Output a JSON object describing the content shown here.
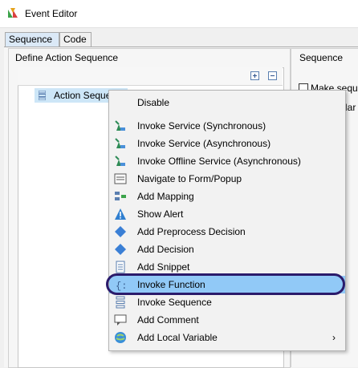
{
  "window": {
    "title": "Event Editor"
  },
  "tabs": [
    {
      "label": "Sequence"
    },
    {
      "label": "Code"
    }
  ],
  "left_group": {
    "title": "Define Action Sequence",
    "tree_item": "Action Sequence"
  },
  "right_group": {
    "title": "Sequence",
    "checkbox_label": "Make sequ",
    "field_label": "Nar"
  },
  "context_menu": {
    "items": [
      {
        "label": "Disable",
        "icon": "none"
      },
      {
        "label": "Invoke Service (Synchronous)",
        "icon": "service-icon"
      },
      {
        "label": "Invoke Service (Asynchronous)",
        "icon": "service-icon"
      },
      {
        "label": "Invoke Offline Service (Asynchronous)",
        "icon": "service-icon"
      },
      {
        "label": "Navigate to Form/Popup",
        "icon": "form-icon"
      },
      {
        "label": "Add Mapping",
        "icon": "mapping-icon"
      },
      {
        "label": "Show Alert",
        "icon": "alert-icon"
      },
      {
        "label": "Add Preprocess Decision",
        "icon": "diamond-icon"
      },
      {
        "label": "Add Decision",
        "icon": "diamond-icon"
      },
      {
        "label": "Add Snippet",
        "icon": "snippet-icon"
      },
      {
        "label": "Invoke Function",
        "icon": "function-icon"
      },
      {
        "label": "Invoke Sequence",
        "icon": "sequence-icon"
      },
      {
        "label": "Add Comment",
        "icon": "comment-icon"
      },
      {
        "label": "Add Local Variable",
        "icon": "globe-icon",
        "submenu": "›"
      }
    ],
    "highlighted_index": 10,
    "highlight_color": "#91c9f7",
    "ring_color": "#2b1b6b"
  }
}
